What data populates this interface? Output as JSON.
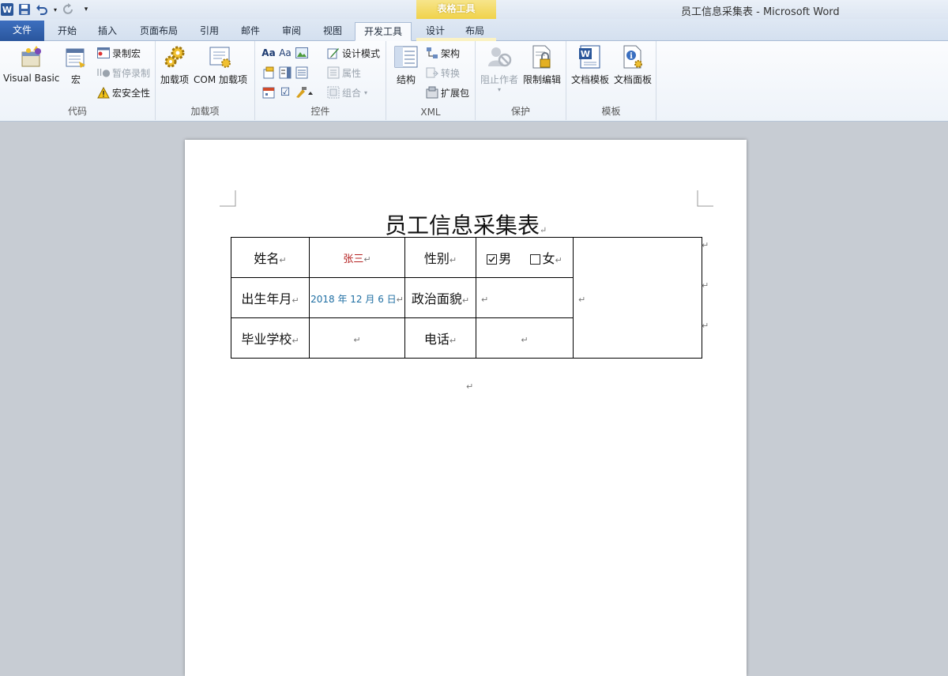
{
  "window": {
    "title": "员工信息采集表 - Microsoft Word",
    "context_tab_group": "表格工具"
  },
  "tabs": [
    "文件",
    "开始",
    "插入",
    "页面布局",
    "引用",
    "邮件",
    "审阅",
    "视图",
    "开发工具",
    "设计",
    "布局"
  ],
  "active_tab": "开发工具",
  "ribbon": {
    "code": {
      "label": "代码",
      "visual_basic": "Visual Basic",
      "macro": "宏",
      "record_macro": "录制宏",
      "pause_record": "暂停录制",
      "macro_security": "宏安全性"
    },
    "addins": {
      "label": "加载项",
      "addins": "加载项",
      "com_addins": "COM 加载项"
    },
    "controls": {
      "label": "控件",
      "design_mode": "设计模式",
      "properties": "属性",
      "group": "组合"
    },
    "xml": {
      "label": "XML",
      "structure": "结构",
      "schema": "架构",
      "transform": "转换",
      "expansion_pack": "扩展包"
    },
    "protect": {
      "label": "保护",
      "block_authors": "阻止作者",
      "restrict_editing": "限制编辑"
    },
    "templates": {
      "label": "模板",
      "document_template": "文档模板",
      "document_panel": "文档面板"
    }
  },
  "document": {
    "title": "员工信息采集表",
    "para_mark": "↵",
    "form": {
      "name_label": "姓名",
      "name_value": "张三",
      "gender_label": "性别",
      "gender_male": "男",
      "gender_female": "女",
      "gender_male_checked": true,
      "birth_label": "出生年月",
      "birth_value": "2018 年 12 月 6 日",
      "political_label": "政治面貌",
      "school_label": "毕业学校",
      "phone_label": "电话"
    }
  },
  "colors": {
    "file_tab": "#2a569d",
    "context_tab": "#f0d24a",
    "name_value": "#b42020",
    "date_value": "#1f6fa3"
  }
}
